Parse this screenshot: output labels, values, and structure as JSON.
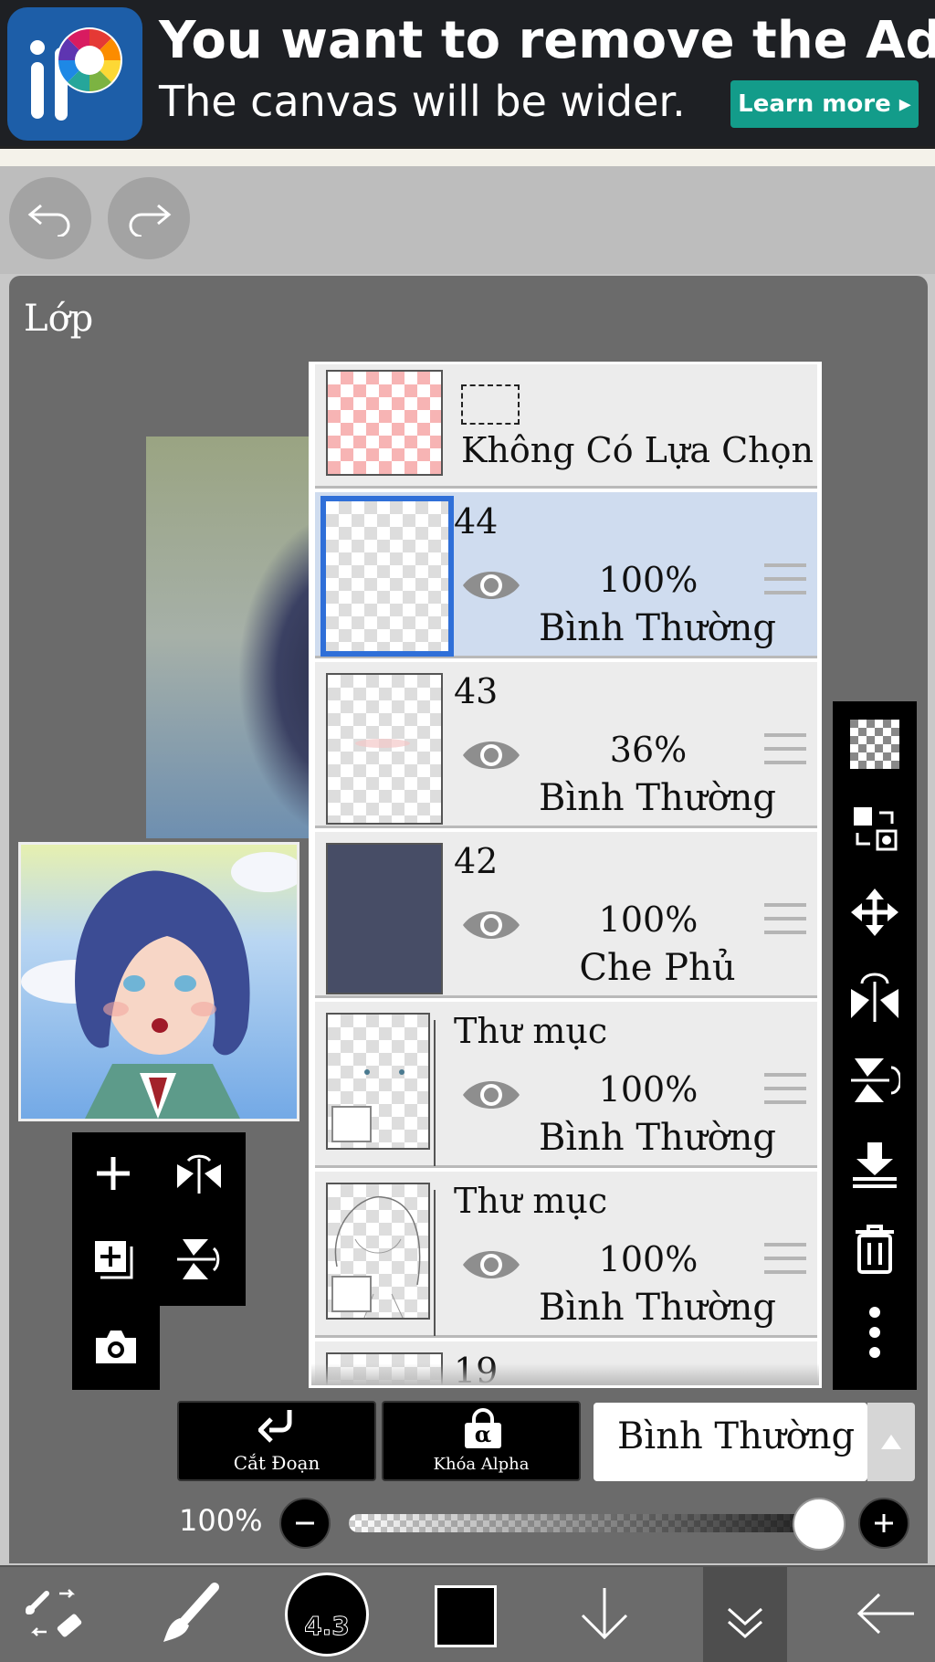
{
  "ad": {
    "title": "You want to remove the Ad?",
    "subtitle": "The canvas will be wider.",
    "button": "Learn more ▸"
  },
  "toolbar_top": {
    "undo_icon": "undo-icon",
    "redo_icon": "redo-icon"
  },
  "panel": {
    "title": "Lớp"
  },
  "layers": [
    {
      "name": "",
      "selection_label": "Không Có Lựa Chọn",
      "type": "selection"
    },
    {
      "name": "44",
      "opacity": "100%",
      "blend": "Bình Thường",
      "selected": true
    },
    {
      "name": "43",
      "opacity": "36%",
      "blend": "Bình Thường"
    },
    {
      "name": "42",
      "opacity": "100%",
      "blend": "Che Phủ"
    },
    {
      "name": "Thư mục",
      "opacity": "100%",
      "blend": "Bình Thường",
      "folder": true
    },
    {
      "name": "Thư mục",
      "opacity": "100%",
      "blend": "Bình Thường",
      "folder": true
    },
    {
      "name": "19"
    }
  ],
  "bottom_controls": {
    "clip_label": "Cắt Đoạn",
    "alpha_lock_label": "Khóa Alpha",
    "alpha_symbol": "α",
    "blend_mode": "Bình Thường",
    "opacity": "100%",
    "opacity_value": 1.0
  },
  "bottom_nav": {
    "brush_size": "4.3"
  },
  "colors": {
    "accent_blue": "#2f6fd8",
    "ad_teal": "#139c8a",
    "panel_gray": "#6b6b6b"
  }
}
